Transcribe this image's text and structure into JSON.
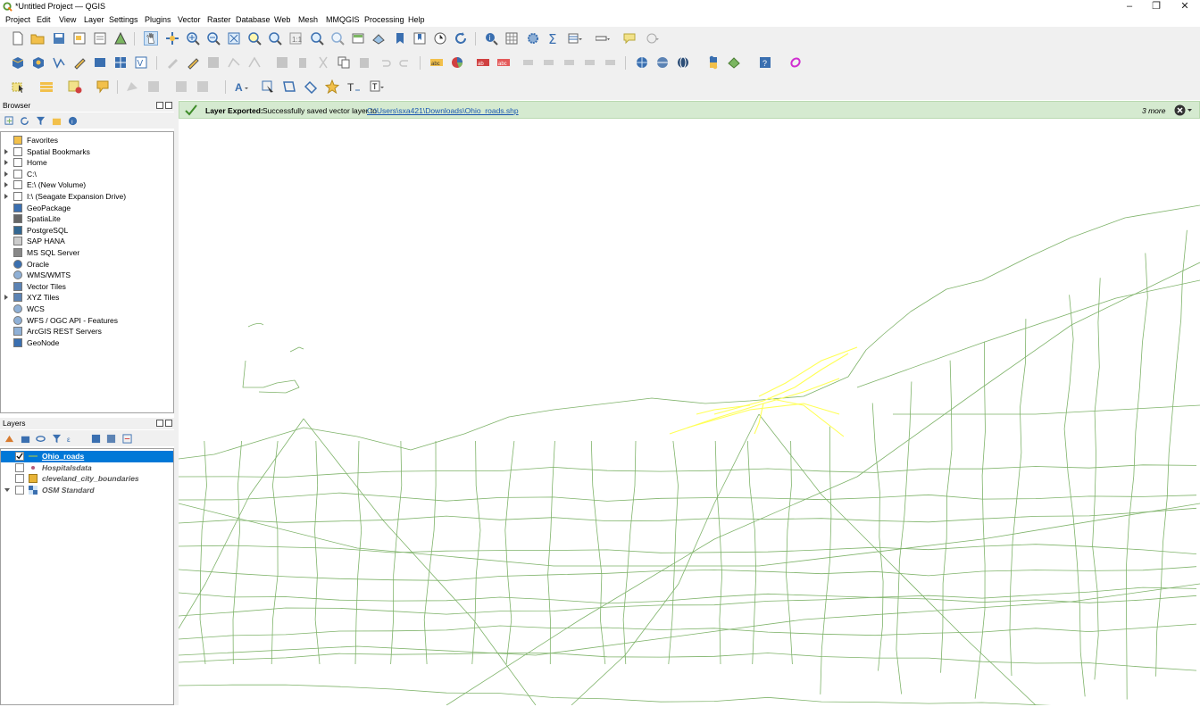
{
  "window": {
    "title": "*Untitled Project — QGIS",
    "minimize": "–",
    "restore": "❐",
    "close": "✕"
  },
  "menu": [
    "Project",
    "Edit",
    "View",
    "Layer",
    "Settings",
    "Plugins",
    "Vector",
    "Raster",
    "Database",
    "Web",
    "Mesh",
    "MMQGIS",
    "Processing",
    "Help"
  ],
  "browser": {
    "title": "Browser",
    "items": [
      {
        "label": "Favorites",
        "icon": "star-icon",
        "expand": false
      },
      {
        "label": "Spatial Bookmarks",
        "icon": "bookmark-icon",
        "expand": true
      },
      {
        "label": "Home",
        "icon": "home-folder-icon",
        "expand": true
      },
      {
        "label": "C:\\",
        "icon": "folder-icon",
        "expand": true
      },
      {
        "label": "E:\\ (New Volume)",
        "icon": "folder-icon",
        "expand": true
      },
      {
        "label": "I:\\ (Seagate Expansion Drive)",
        "icon": "folder-icon",
        "expand": true
      },
      {
        "label": "GeoPackage",
        "icon": "geopackage-icon",
        "expand": false
      },
      {
        "label": "SpatiaLite",
        "icon": "spatialite-icon",
        "expand": false
      },
      {
        "label": "PostgreSQL",
        "icon": "postgresql-icon",
        "expand": false
      },
      {
        "label": "SAP HANA",
        "icon": "hana-icon",
        "expand": false
      },
      {
        "label": "MS SQL Server",
        "icon": "mssql-icon",
        "expand": false
      },
      {
        "label": "Oracle",
        "icon": "oracle-icon",
        "expand": false
      },
      {
        "label": "WMS/WMTS",
        "icon": "globe-icon",
        "expand": false
      },
      {
        "label": "Vector Tiles",
        "icon": "grid-icon",
        "expand": false
      },
      {
        "label": "XYZ Tiles",
        "icon": "grid-icon",
        "expand": true
      },
      {
        "label": "WCS",
        "icon": "globe-icon",
        "expand": false
      },
      {
        "label": "WFS / OGC API - Features",
        "icon": "globe-icon",
        "expand": false
      },
      {
        "label": "ArcGIS REST Servers",
        "icon": "arcgis-icon",
        "expand": false
      },
      {
        "label": "GeoNode",
        "icon": "geonode-icon",
        "expand": false
      }
    ]
  },
  "layers": {
    "title": "Layers",
    "items": [
      {
        "label": "Ohio_roads",
        "checked": true,
        "selected": true,
        "symbol": "line-symbol-icon"
      },
      {
        "label": "Hospitalsdata",
        "checked": false,
        "selected": false,
        "symbol": "point-symbol-icon"
      },
      {
        "label": "cleveland_city_boundaries",
        "checked": false,
        "selected": false,
        "symbol": "polygon-symbol-icon"
      },
      {
        "label": "OSM Standard",
        "checked": false,
        "selected": false,
        "symbol": "raster-tile-icon"
      }
    ]
  },
  "message": {
    "title": "Layer Exported:",
    "text": "Successfully saved vector layer to",
    "link": "C:\\Users\\sxa421\\Downloads\\Ohio_roads.shp",
    "more": "3 more"
  },
  "colors": {
    "road": "#7fb36a",
    "selected_road": "#ffff55",
    "msg_bg": "#d5ead0",
    "selection": "#0078d7"
  }
}
